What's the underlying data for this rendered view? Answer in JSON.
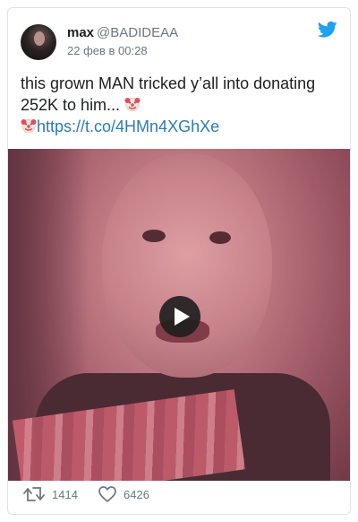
{
  "author": {
    "display_name": "max",
    "handle": "@BADIDEAA",
    "date": "22 фев в 00:28"
  },
  "tweet": {
    "text": "this grown MAN tricked y’all into donating 252K to him...",
    "link": "https://t.co/4HMn4XGhXe"
  },
  "stats": {
    "retweets": "1414",
    "likes": "6426"
  },
  "icons": {
    "brand": "twitter-bird-icon",
    "emoji": "clown-face-icon",
    "play": "play-icon",
    "retweet": "retweet-icon",
    "like": "heart-icon"
  },
  "colors": {
    "brand_blue": "#1da1f2",
    "link_blue": "#2b7bb9",
    "secondary_text": "#697882"
  }
}
